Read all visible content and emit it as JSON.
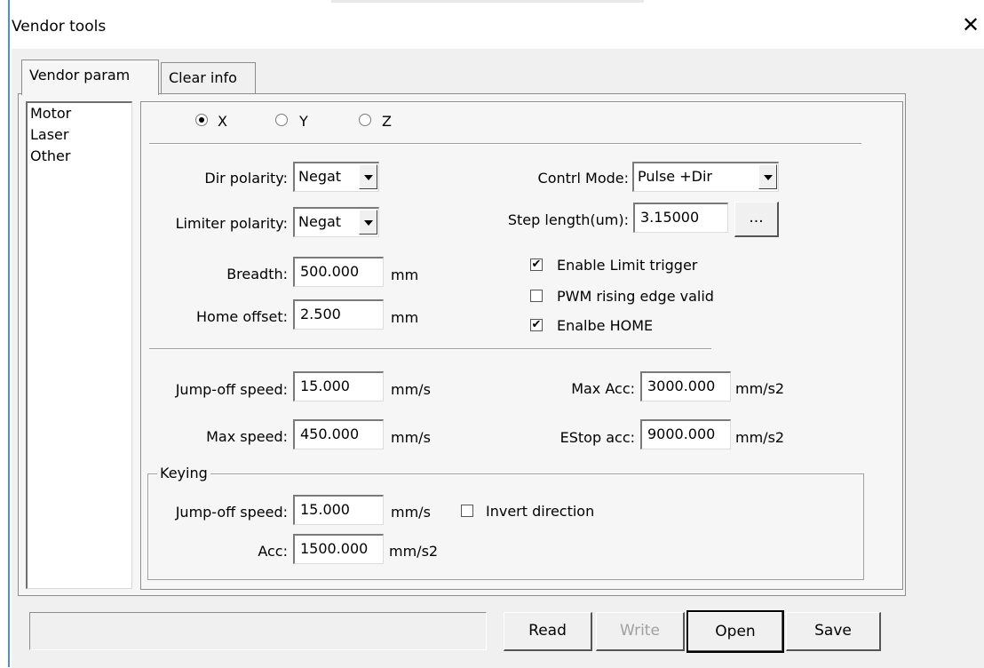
{
  "window": {
    "title": "Vendor tools",
    "close_icon": "close-icon"
  },
  "tabs": [
    {
      "label": "Vendor param"
    },
    {
      "label": "Clear info"
    }
  ],
  "sidebar": {
    "items": [
      {
        "label": "Motor"
      },
      {
        "label": "Laser"
      },
      {
        "label": "Other"
      }
    ]
  },
  "axis": {
    "options": [
      {
        "label": "X"
      },
      {
        "label": "Y"
      },
      {
        "label": "Z"
      }
    ],
    "selected": "X"
  },
  "motor": {
    "dir_polarity": {
      "label": "Dir polarity:",
      "value": "Negat"
    },
    "limiter_polarity": {
      "label": "Limiter polarity:",
      "value": "Negat"
    },
    "control_mode": {
      "label": "Contrl Mode:",
      "value": "Pulse +Dir"
    },
    "step_length": {
      "label": "Step length(um):",
      "value": "3.15000",
      "browse_label": "..."
    },
    "breadth": {
      "label": "Breadth:",
      "value": "500.000",
      "unit": "mm"
    },
    "home_offset": {
      "label": "Home offset:",
      "value": "2.500",
      "unit": "mm"
    },
    "enable_limit_trigger": {
      "label": "Enable Limit trigger",
      "checked": true,
      "mark": "✔"
    },
    "pwm_rising_edge": {
      "label": "PWM rising edge valid",
      "checked": false,
      "mark": ""
    },
    "enable_home": {
      "label": "Enalbe HOME",
      "checked": true,
      "mark": "✔"
    },
    "jump_off_speed": {
      "label": "Jump-off speed:",
      "value": "15.000",
      "unit": "mm/s"
    },
    "max_speed": {
      "label": "Max speed:",
      "value": "450.000",
      "unit": "mm/s"
    },
    "max_acc": {
      "label": "Max Acc:",
      "value": "3000.000",
      "unit": "mm/s2"
    },
    "estop_acc": {
      "label": "EStop acc:",
      "value": "9000.000",
      "unit": "mm/s2"
    }
  },
  "keying": {
    "title": "Keying",
    "jump_off_speed": {
      "label": "Jump-off speed:",
      "value": "15.000",
      "unit": "mm/s"
    },
    "invert_direction": {
      "label": "Invert direction",
      "checked": false,
      "mark": ""
    },
    "acc": {
      "label": "Acc:",
      "value": "1500.000",
      "unit": "mm/s2"
    }
  },
  "footer": {
    "status_text": "",
    "read_label": "Read",
    "write_label": "Write",
    "open_label": "Open",
    "save_label": "Save"
  }
}
